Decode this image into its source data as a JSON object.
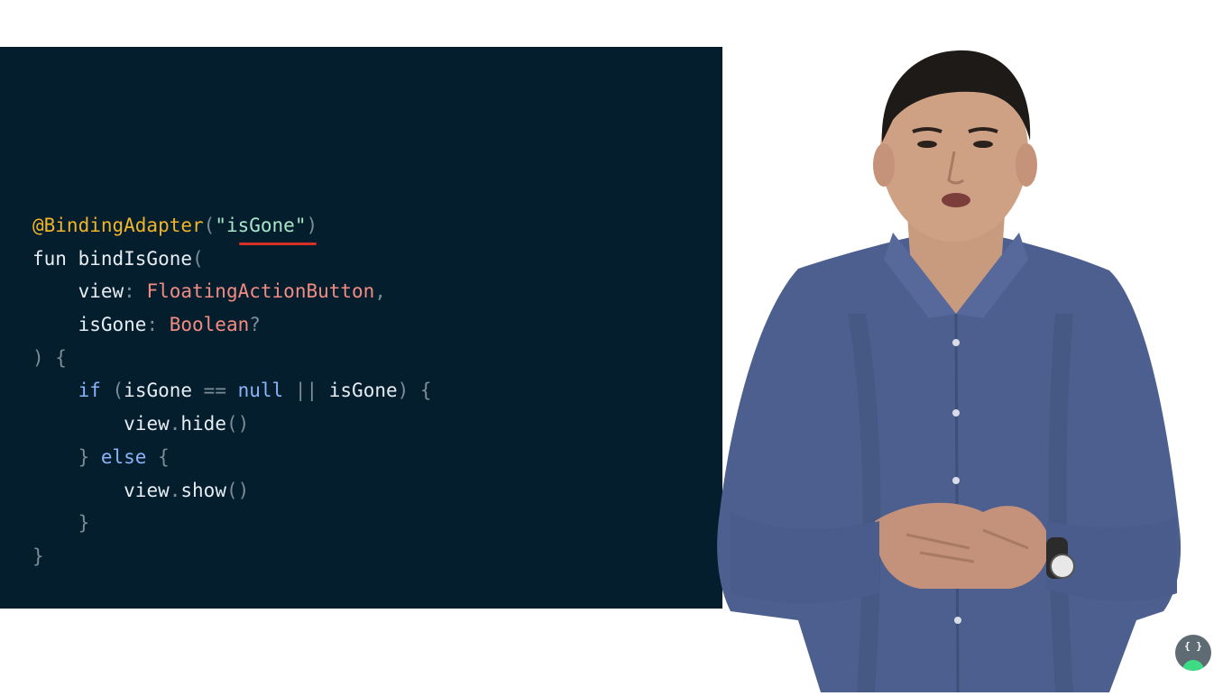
{
  "code": {
    "line1": {
      "annotation": "@BindingAdapter",
      "open": "(",
      "string": "\"isGone\"",
      "close": ")"
    },
    "line2": {
      "keyword": "fun ",
      "name": "bindIsGone",
      "open": "("
    },
    "line3": {
      "indent": "    ",
      "param": "view",
      "colon": ": ",
      "type": "FloatingActionButton",
      "comma": ","
    },
    "line4": {
      "indent": "    ",
      "param": "isGone",
      "colon": ": ",
      "type": "Boolean",
      "q": "?"
    },
    "line5": {
      "text": ") {"
    },
    "line6": {
      "indent": "    ",
      "kw_if": "if",
      "sp1": " (",
      "var1": "isGone",
      "op": " == ",
      "kw_null": "null",
      "or": " || ",
      "var2": "isGone",
      "close": ") {"
    },
    "line7": {
      "indent": "        ",
      "obj": "view",
      "dot": ".",
      "call": "hide",
      "parens": "()"
    },
    "line8": {
      "indent": "    ",
      "brace": "} ",
      "kw_else": "else",
      "open": " {"
    },
    "line9": {
      "indent": "        ",
      "obj": "view",
      "dot": ".",
      "call": "show",
      "parens": "()"
    },
    "line10": {
      "indent": "    ",
      "brace": "}"
    },
    "line11": {
      "brace": "}"
    }
  },
  "colors": {
    "panel_bg": "#051e2e",
    "annotation": "#f0b429",
    "string": "#a8e6c8",
    "type": "#f28b82",
    "keyword": "#8ab4f8",
    "underline": "#d93025"
  },
  "logo": {
    "icon": "android-developers-icon",
    "glyph": "{ }"
  }
}
